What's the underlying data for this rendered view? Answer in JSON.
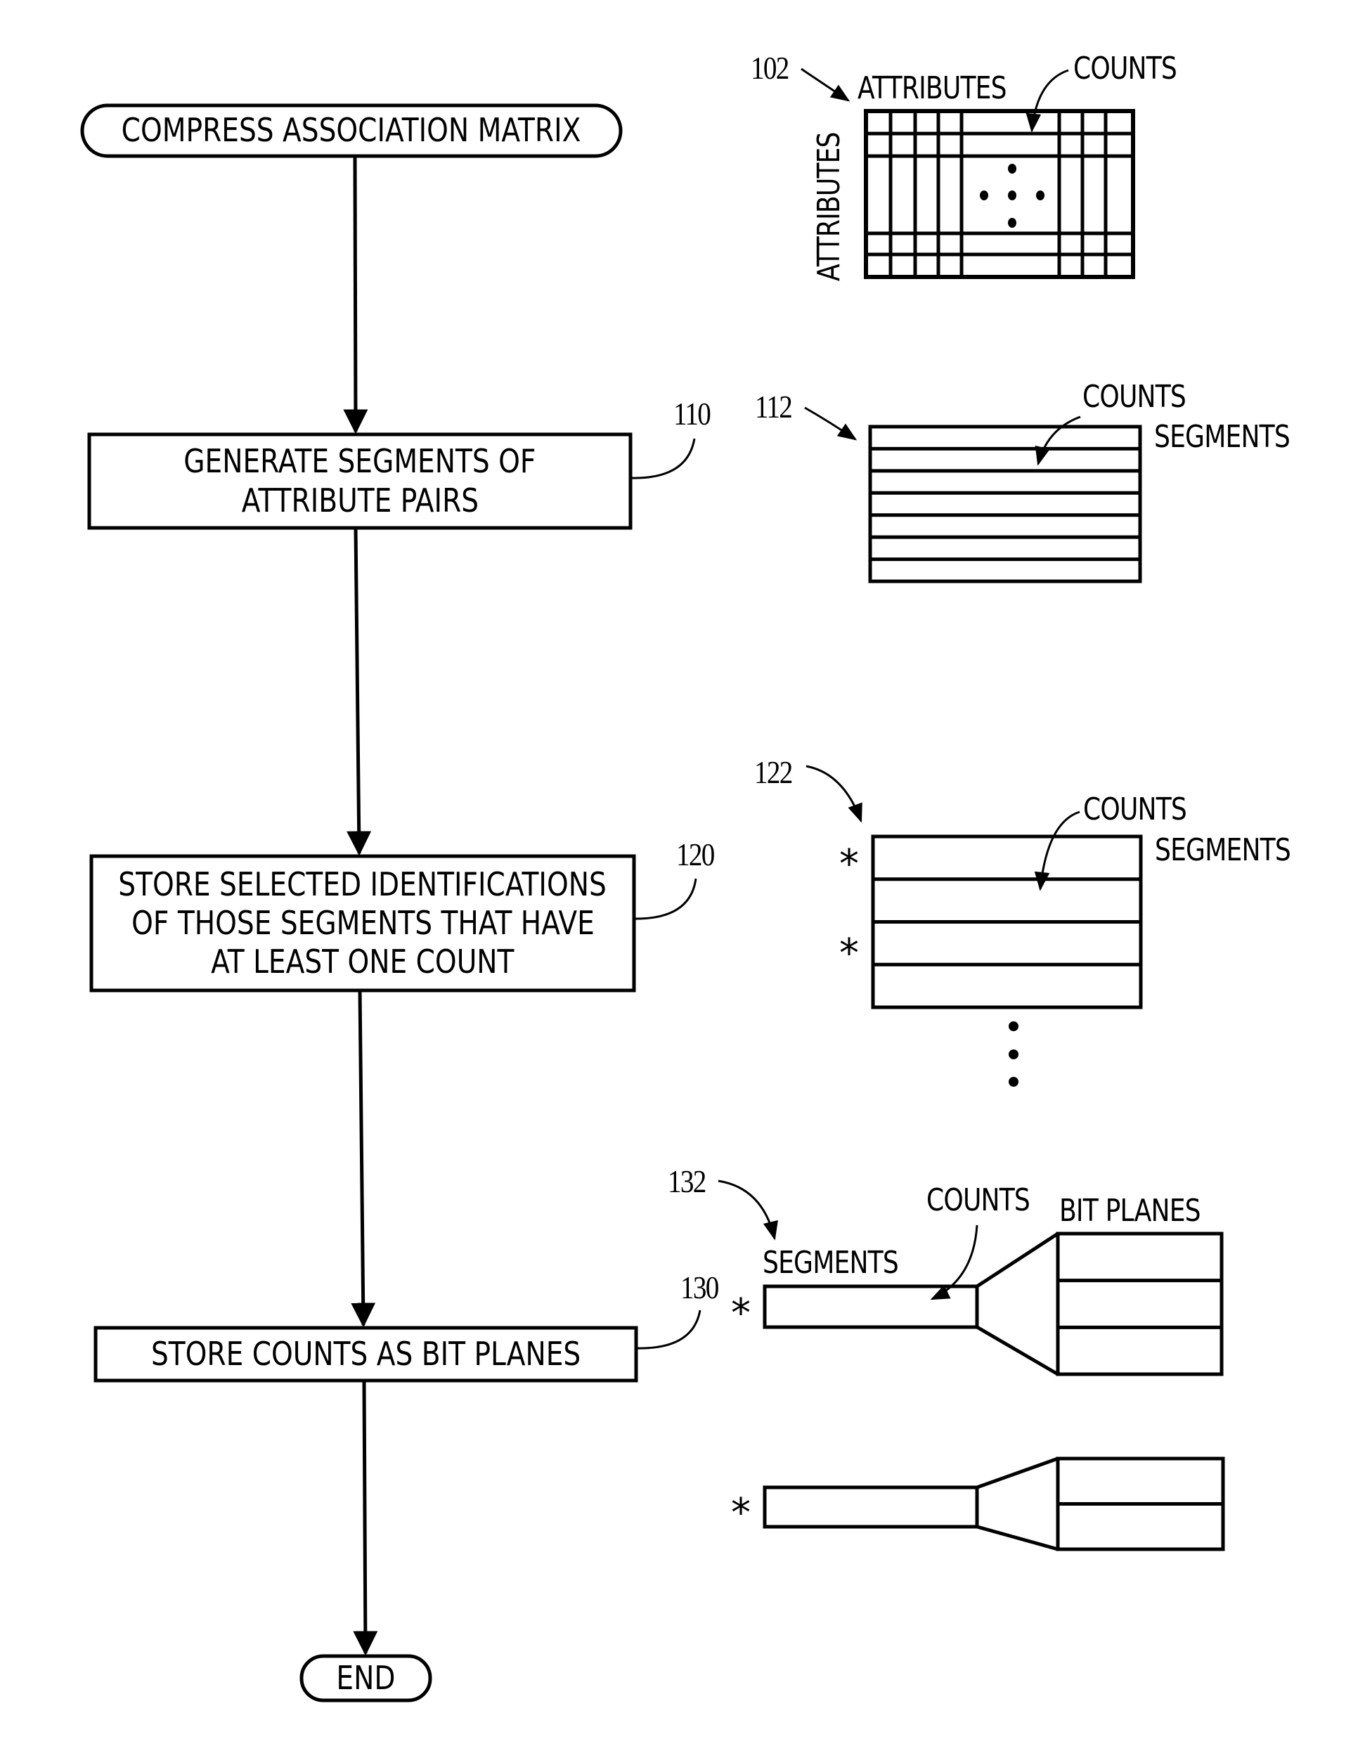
{
  "figure": {
    "flowchart": {
      "start": {
        "label": "COMPRESS ASSOCIATION MATRIX"
      },
      "steps": [
        {
          "ref": "110",
          "lines": [
            "GENERATE SEGMENTS OF",
            "ATTRIBUTE PAIRS"
          ]
        },
        {
          "ref": "120",
          "lines": [
            "STORE SELECTED IDENTIFICATIONS",
            "OF THOSE SEGMENTS THAT HAVE",
            "AT LEAST ONE COUNT"
          ]
        },
        {
          "ref": "130",
          "lines": [
            "STORE COUNTS AS BIT PLANES"
          ]
        }
      ],
      "end": {
        "label": "END"
      }
    },
    "illustrations": {
      "matrix": {
        "ref": "102",
        "top_label": "ATTRIBUTES",
        "side_label": "ATTRIBUTES",
        "pointer_label": "COUNTS",
        "ellipsis": "dots"
      },
      "segments": {
        "ref": "112",
        "pointer_label": "COUNTS",
        "side_label": "SEGMENTS",
        "rows": 7
      },
      "selected_segments": {
        "ref": "122",
        "pointer_label": "COUNTS",
        "side_label": "SEGMENTS",
        "rows": 4,
        "marker": "*",
        "marked_rows": [
          1,
          3
        ],
        "continuation": "vertical-ellipsis"
      },
      "bit_planes": {
        "ref": "132",
        "segments_label": "SEGMENTS",
        "counts_label": "COUNTS",
        "bitplanes_label": "BIT PLANES",
        "marker": "*",
        "groups": [
          {
            "planes": 3
          },
          {
            "planes": 2
          }
        ]
      }
    }
  }
}
